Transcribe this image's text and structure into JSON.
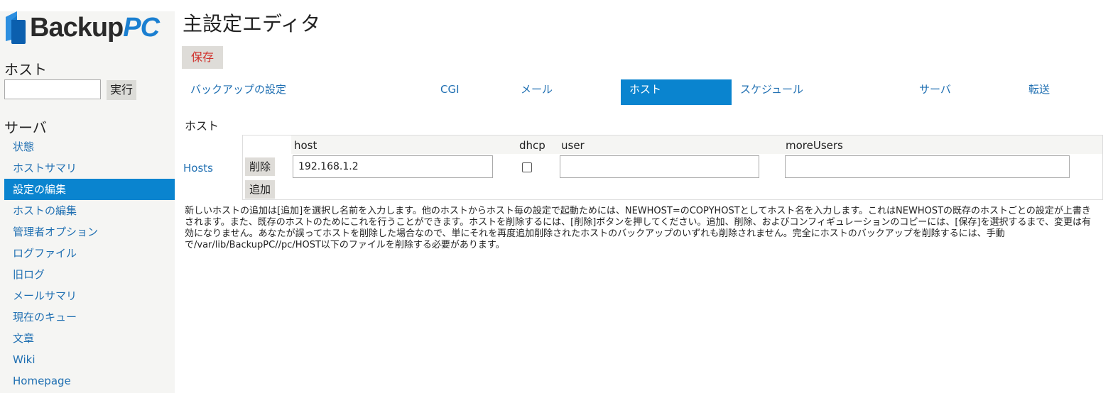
{
  "logo": {
    "text_main": "Backup",
    "text_accent": "PC",
    "brand_color": "#1a7fd1"
  },
  "sidebar": {
    "host_heading": "ホスト",
    "host_input_value": "",
    "go_button": "実行",
    "server_heading": "サーバ",
    "items": [
      {
        "label": "状態",
        "active": false
      },
      {
        "label": "ホストサマリ",
        "active": false
      },
      {
        "label": "設定の編集",
        "active": true
      },
      {
        "label": "ホストの編集",
        "active": false
      },
      {
        "label": "管理者オプション",
        "active": false
      },
      {
        "label": "ログファイル",
        "active": false
      },
      {
        "label": "旧ログ",
        "active": false
      },
      {
        "label": "メールサマリ",
        "active": false
      },
      {
        "label": "現在のキュー",
        "active": false
      },
      {
        "label": "文章",
        "active": false
      },
      {
        "label": "Wiki",
        "active": false
      },
      {
        "label": "Homepage",
        "active": false
      }
    ],
    "active_color": "#0a84cf"
  },
  "main": {
    "title": "主設定エディタ",
    "save_button": "保存",
    "tabs": [
      {
        "label": "バックアップの設定",
        "active": false
      },
      {
        "label": "CGI",
        "active": false
      },
      {
        "label": "メール",
        "active": false
      },
      {
        "label": "ホスト",
        "active": true
      },
      {
        "label": "スケジュール",
        "active": false
      },
      {
        "label": "サーバ",
        "active": false
      },
      {
        "label": "転送",
        "active": false
      }
    ],
    "section_label": "ホスト",
    "hosts_label": "Hosts",
    "table": {
      "columns": [
        "host",
        "dhcp",
        "user",
        "moreUsers"
      ],
      "rows": [
        {
          "host": "192.168.1.2",
          "dhcp": false,
          "user": "",
          "moreUsers": ""
        }
      ],
      "delete_button": "削除",
      "add_button": "追加"
    },
    "help_text": "新しいホストの追加は[追加]を選択し名前を入力します。他のホストからホスト毎の設定で起動ためには、NEWHOST=のCOPYHOSTとしてホスト名を入力します。これはNEWHOSTの既存のホストごとの設定が上書きされます。また、既存のホストのためにこれを行うことができます。ホストを削除するには、[削除]ボタンを押してください。追加、削除、およびコンフィギュレーションのコピーには、[保存]を選択するまで、変更は有効になりません。あなたが誤ってホストを削除した場合なので、単にそれを再度追加削除されたホストのバックアップのいずれも削除されません。完全にホストのバックアップを削除するには、手動で/var/lib/BackupPC//pc/HOST以下のファイルを削除する必要があります。"
  }
}
